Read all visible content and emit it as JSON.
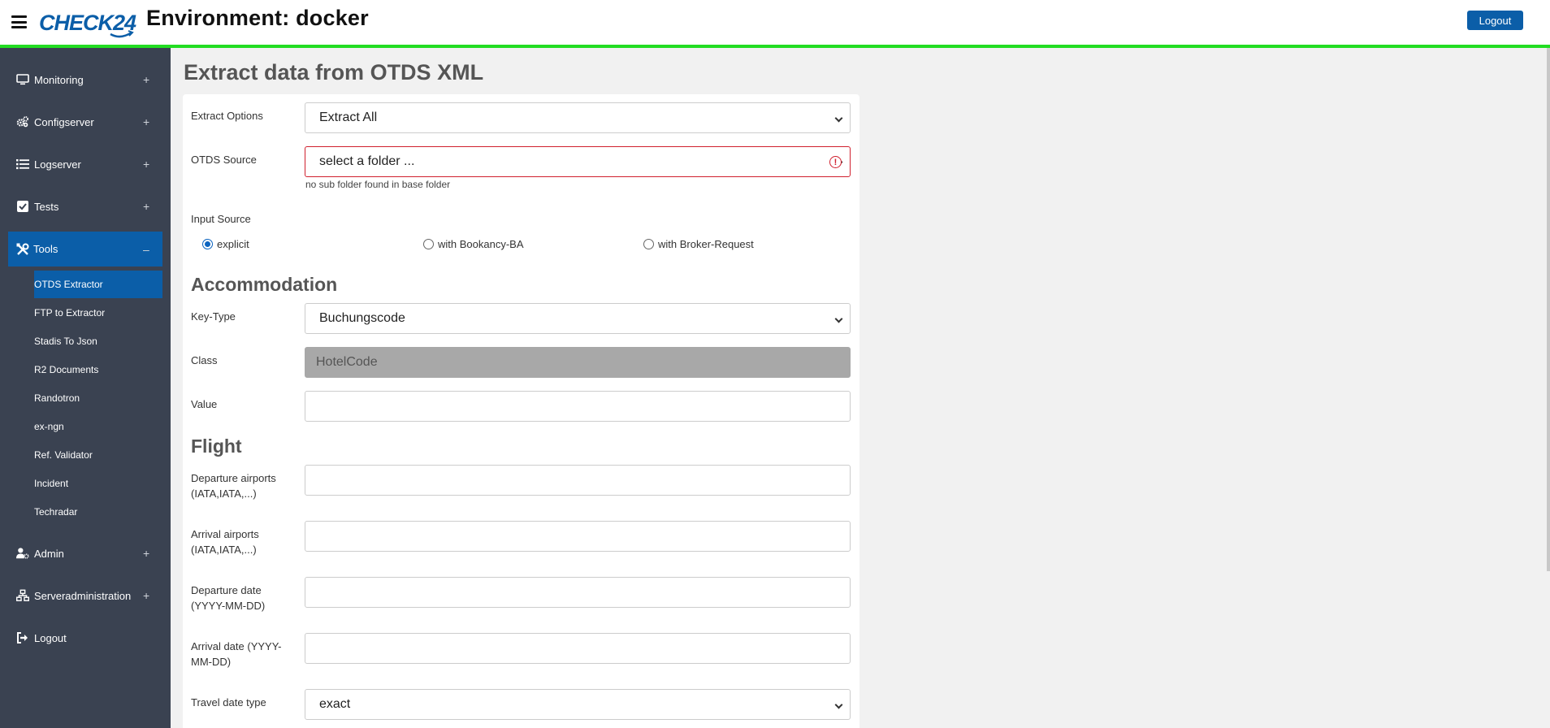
{
  "header": {
    "env_title": "Environment: docker",
    "logo_text": "CHECK24",
    "logout_label": "Logout",
    "accent_color": "#22dd22",
    "brand_color": "#0b5ea8"
  },
  "sidebar": {
    "items": [
      {
        "label": "Monitoring",
        "icon": "monitor-icon",
        "toggle": "+"
      },
      {
        "label": "Configserver",
        "icon": "gears-icon",
        "toggle": "+"
      },
      {
        "label": "Logserver",
        "icon": "list-icon",
        "toggle": "+"
      },
      {
        "label": "Tests",
        "icon": "checkbox-icon",
        "toggle": "+"
      },
      {
        "label": "Tools",
        "icon": "tools-icon",
        "toggle": "–",
        "active": true
      },
      {
        "label": "Admin",
        "icon": "user-gear-icon",
        "toggle": "+"
      },
      {
        "label": "Serveradministration",
        "icon": "network-icon",
        "toggle": "+"
      },
      {
        "label": "Logout",
        "icon": "sign-out-icon",
        "toggle": ""
      }
    ],
    "tools_subitems": [
      "OTDS Extractor",
      "FTP to Extractor",
      "Stadis To Json",
      "R2 Documents",
      "Randotron",
      "ex-ngn",
      "Ref. Validator",
      "Incident",
      "Techradar"
    ],
    "active_subitem": "OTDS Extractor"
  },
  "main": {
    "page_title": "Extract data from OTDS XML",
    "extract_options": {
      "label": "Extract Options",
      "value": "Extract All"
    },
    "otds_source": {
      "label": "OTDS Source",
      "value": "select a folder ...",
      "help": "no sub folder found in base folder"
    },
    "input_source": {
      "label": "Input Source",
      "options": [
        "explicit",
        "with Bookancy-BA",
        "with Broker-Request"
      ],
      "selected": "explicit"
    },
    "accommodation": {
      "heading": "Accommodation",
      "key_type": {
        "label": "Key-Type",
        "value": "Buchungscode"
      },
      "class": {
        "label": "Class",
        "value": "HotelCode"
      },
      "value": {
        "label": "Value",
        "value": ""
      }
    },
    "flight": {
      "heading": "Flight",
      "departure_airports": {
        "label_line1": "Departure airports",
        "label_line2": "(IATA,IATA,...)",
        "value": ""
      },
      "arrival_airports": {
        "label_line1": "Arrival airports",
        "label_line2": "(IATA,IATA,...)",
        "value": ""
      },
      "departure_date": {
        "label_line1": "Departure date",
        "label_line2": "(YYYY-MM-DD)",
        "value": ""
      },
      "arrival_date": {
        "label_line1": "Arrival date (YYYY-",
        "label_line2": "MM-DD)",
        "value": ""
      },
      "travel_date_type": {
        "label": "Travel date type",
        "value": "exact"
      }
    }
  }
}
